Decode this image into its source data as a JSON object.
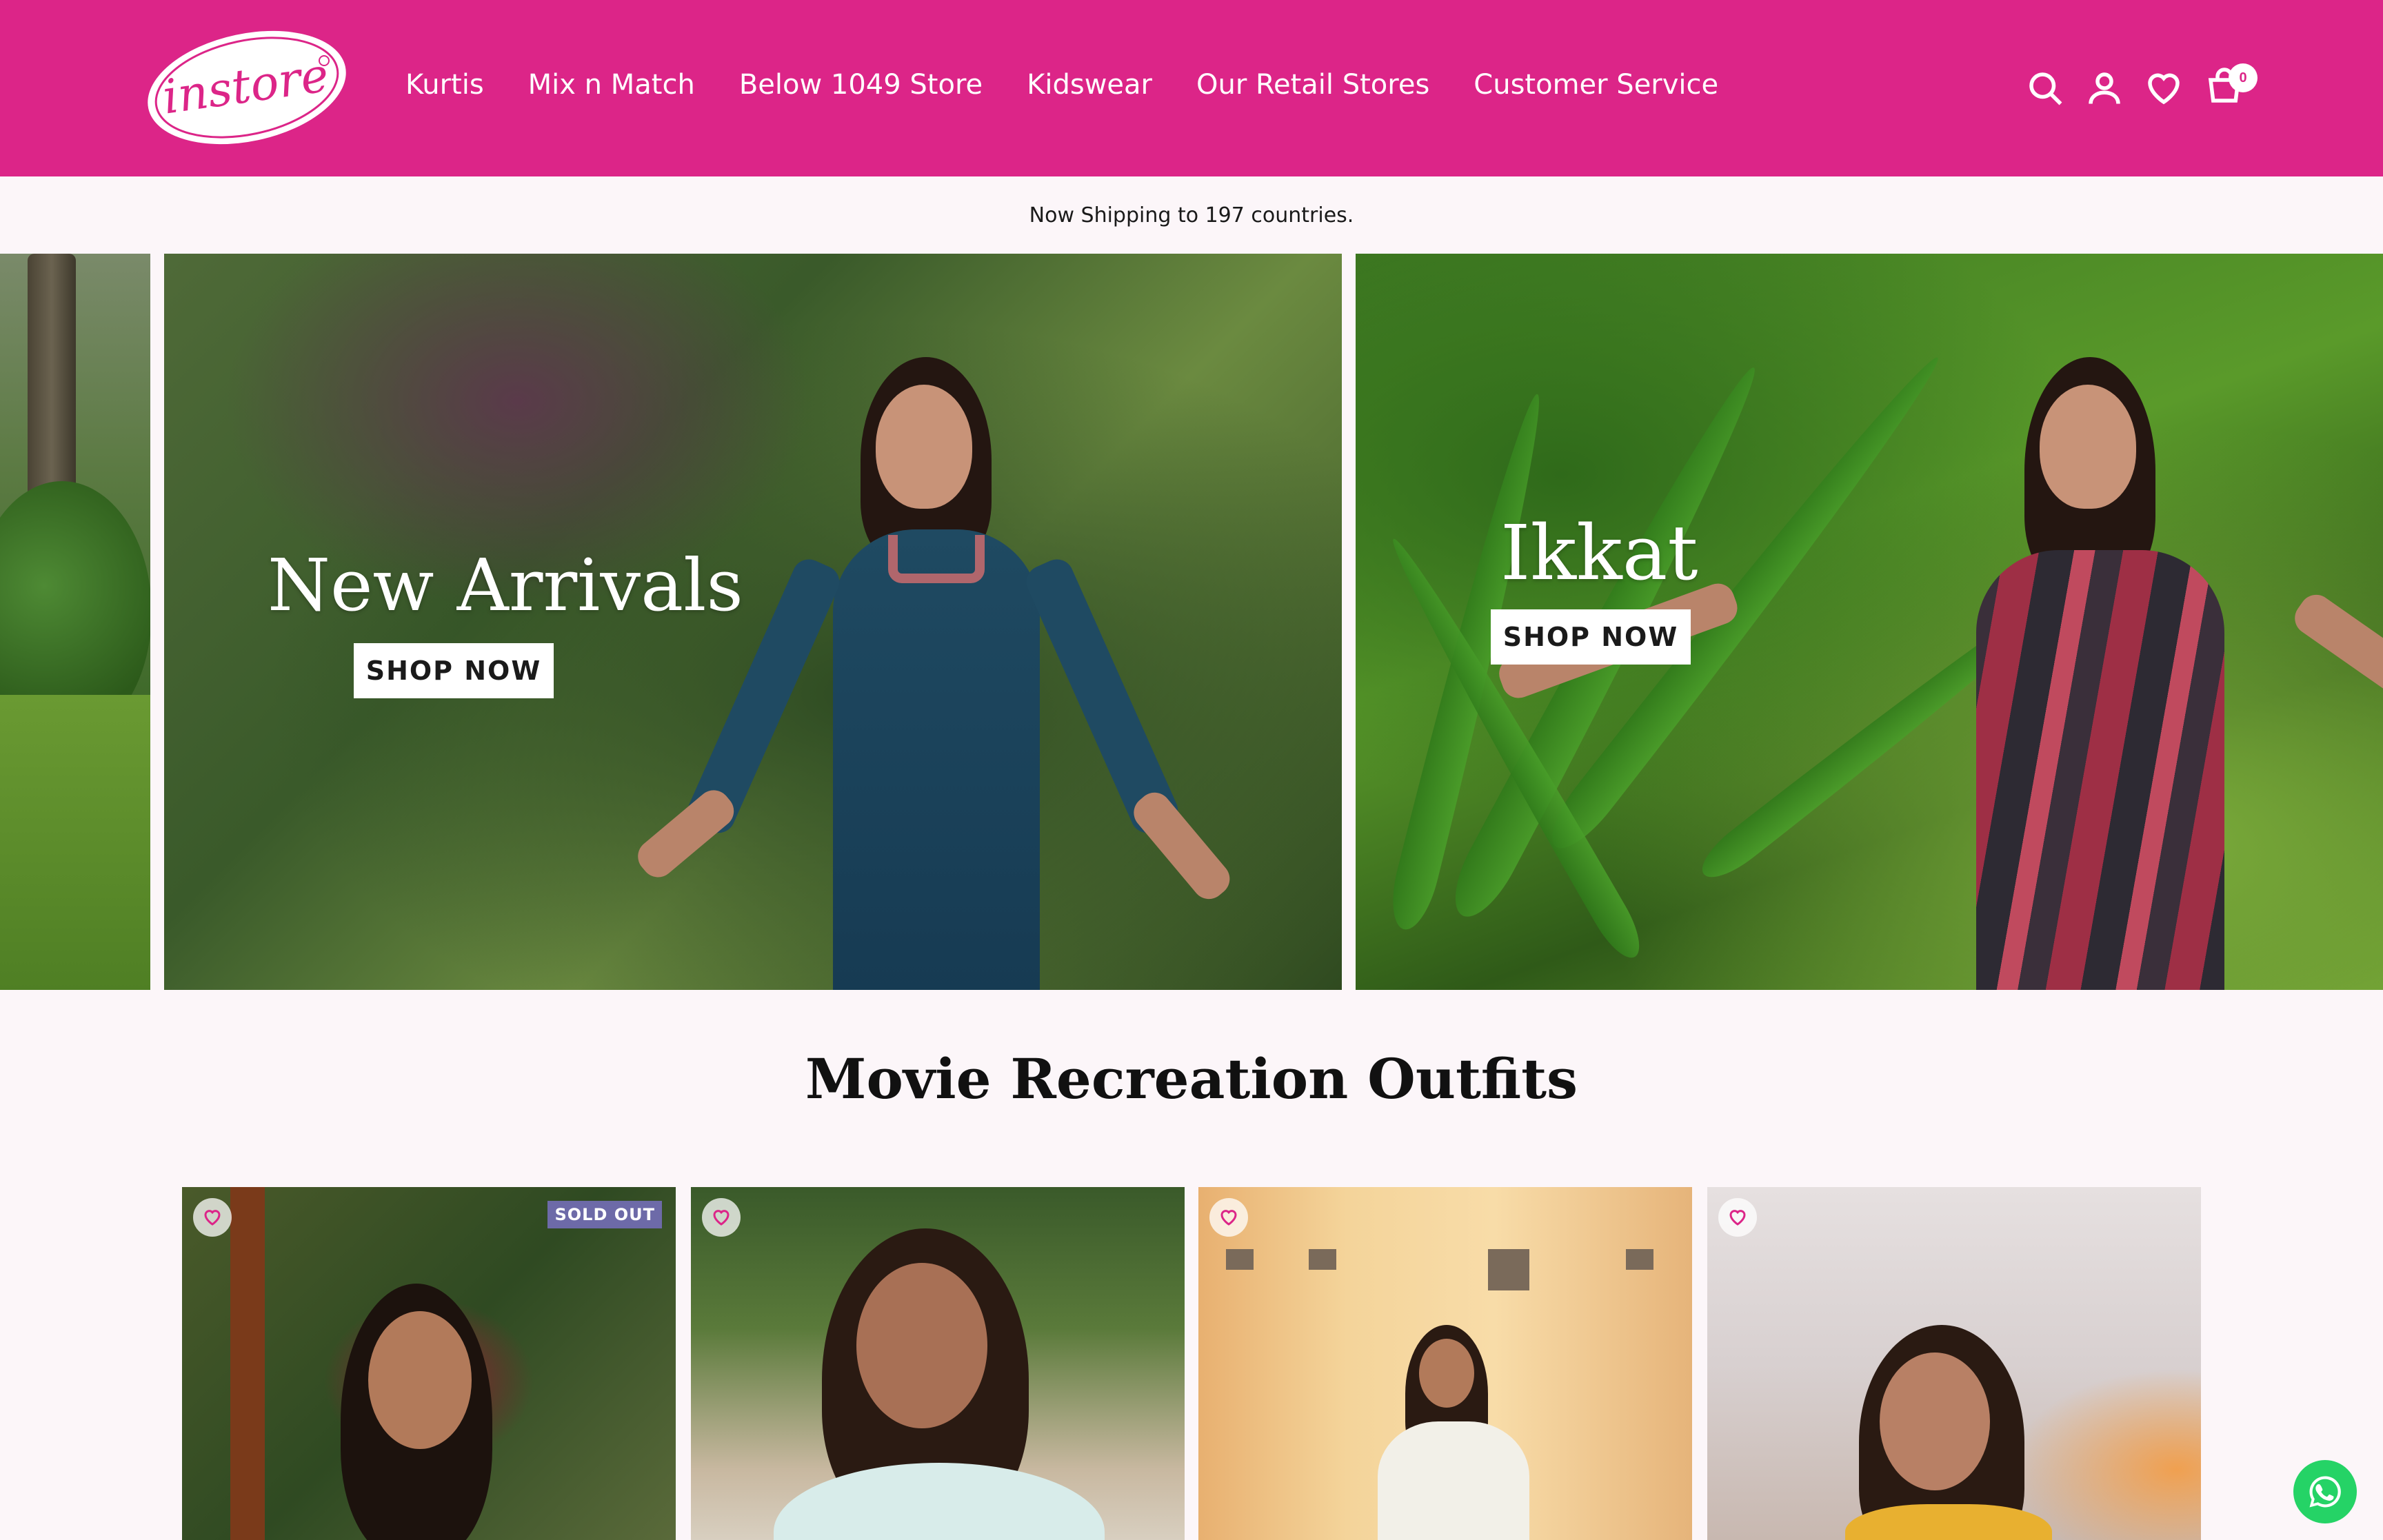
{
  "brand": {
    "logo_text": "instore",
    "color": "#dc2588"
  },
  "nav": {
    "items": [
      "Kurtis",
      "Mix n Match",
      "Below 1049 Store",
      "Kidswear",
      "Our Retail Stores",
      "Customer Service"
    ]
  },
  "header_icons": [
    "search-icon",
    "account-icon",
    "wishlist-icon",
    "cart-icon"
  ],
  "cart": {
    "count": "0"
  },
  "announcement": {
    "text": "Now Shipping to 197 countries."
  },
  "slides": [
    {
      "title": "New Arrivals",
      "button": "SHOP NOW"
    },
    {
      "title": "Ikkat",
      "button": "SHOP NOW"
    }
  ],
  "section": {
    "title": "Movie Recreation Outfits"
  },
  "products": [
    {
      "badge": "SOLD OUT"
    },
    {
      "badge": ""
    },
    {
      "badge": ""
    },
    {
      "badge": ""
    }
  ]
}
